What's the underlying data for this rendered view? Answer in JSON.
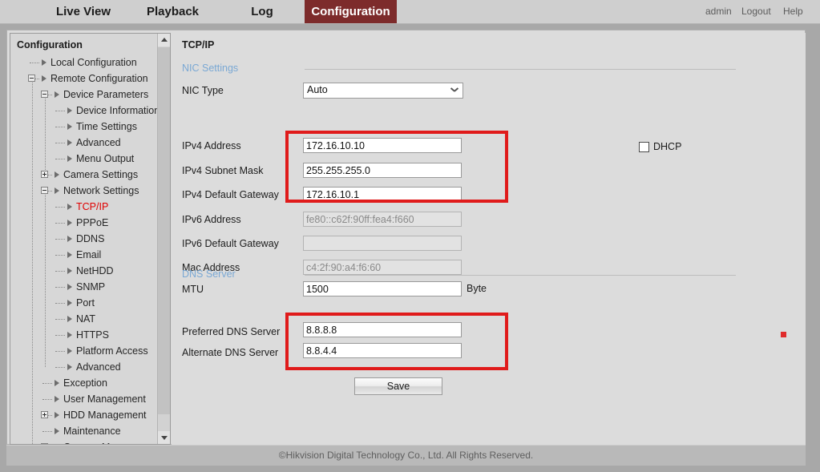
{
  "topnav": {
    "tabs": [
      {
        "label": "Live View",
        "active": false
      },
      {
        "label": "Playback",
        "active": false
      },
      {
        "label": "Log",
        "active": false
      },
      {
        "label": "Configuration",
        "active": true
      }
    ],
    "user": "admin",
    "logout": "Logout",
    "help": "Help"
  },
  "sidebar": {
    "title": "Configuration",
    "items": [
      {
        "label": "Local Configuration",
        "depth": 1,
        "expander": "none"
      },
      {
        "label": "Remote Configuration",
        "depth": 1,
        "expander": "minus"
      },
      {
        "label": "Device Parameters",
        "depth": 2,
        "expander": "minus"
      },
      {
        "label": "Device Information",
        "depth": 3,
        "expander": "none"
      },
      {
        "label": "Time Settings",
        "depth": 3,
        "expander": "none"
      },
      {
        "label": "Advanced",
        "depth": 3,
        "expander": "none"
      },
      {
        "label": "Menu Output",
        "depth": 3,
        "expander": "none"
      },
      {
        "label": "Camera Settings",
        "depth": 2,
        "expander": "plus"
      },
      {
        "label": "Network Settings",
        "depth": 2,
        "expander": "minus"
      },
      {
        "label": "TCP/IP",
        "depth": 3,
        "expander": "none",
        "selected": true
      },
      {
        "label": "PPPoE",
        "depth": 3,
        "expander": "none"
      },
      {
        "label": "DDNS",
        "depth": 3,
        "expander": "none"
      },
      {
        "label": "Email",
        "depth": 3,
        "expander": "none"
      },
      {
        "label": "NetHDD",
        "depth": 3,
        "expander": "none"
      },
      {
        "label": "SNMP",
        "depth": 3,
        "expander": "none"
      },
      {
        "label": "Port",
        "depth": 3,
        "expander": "none"
      },
      {
        "label": "NAT",
        "depth": 3,
        "expander": "none"
      },
      {
        "label": "HTTPS",
        "depth": 3,
        "expander": "none"
      },
      {
        "label": "Platform Access",
        "depth": 3,
        "expander": "none"
      },
      {
        "label": "Advanced",
        "depth": 3,
        "expander": "none"
      },
      {
        "label": "Exception",
        "depth": 2,
        "expander": "none"
      },
      {
        "label": "User Management",
        "depth": 2,
        "expander": "none"
      },
      {
        "label": "HDD Management",
        "depth": 2,
        "expander": "plus"
      },
      {
        "label": "Maintenance",
        "depth": 2,
        "expander": "none"
      },
      {
        "label": "Camera Management",
        "depth": 2,
        "expander": "plus"
      }
    ]
  },
  "content": {
    "title": "TCP/IP",
    "sections": {
      "nic": "NIC Settings",
      "dns": "DNS Server"
    },
    "fields": {
      "nic_type_label": "NIC Type",
      "nic_type_value": "Auto",
      "ipv4_address_label": "IPv4 Address",
      "ipv4_address_value": "172.16.10.10",
      "ipv4_subnet_label": "IPv4 Subnet Mask",
      "ipv4_subnet_value": "255.255.255.0",
      "ipv4_gateway_label": "IPv4 Default Gateway",
      "ipv4_gateway_value": "172.16.10.1",
      "ipv6_address_label": "IPv6 Address",
      "ipv6_address_value": "fe80::c62f:90ff:fea4:f660",
      "ipv6_gateway_label": "IPv6 Default Gateway",
      "ipv6_gateway_value": "",
      "mac_label": "Mac Address",
      "mac_value": "c4:2f:90:a4:f6:60",
      "mtu_label": "MTU",
      "mtu_value": "1500",
      "mtu_unit": "Byte",
      "dhcp_label": "DHCP",
      "dhcp_checked": false,
      "preferred_dns_label": "Preferred DNS Server",
      "preferred_dns_value": "8.8.8.8",
      "alternate_dns_label": "Alternate DNS Server",
      "alternate_dns_value": "8.8.4.4"
    },
    "save_label": "Save"
  },
  "footer": {
    "text": "©Hikvision Digital Technology Co., Ltd. All Rights Reserved."
  },
  "colors": {
    "active_tab": "#7d2b2b",
    "selected_tree_item": "#e00000",
    "section_heading": "#7aa8d4",
    "annotation": "#e01b1b"
  }
}
